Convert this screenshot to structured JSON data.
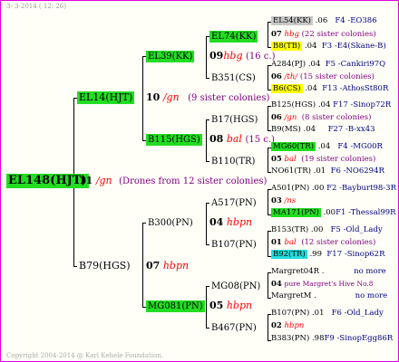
{
  "header": "3-  3-2014 ( 12: 26)",
  "copyright": "Copyright 2004-2014 @ Karl Kehele Foundation.",
  "root": {
    "code": "EL148(HJT)",
    "num": "11",
    "sub": "/gn",
    "note": "(Drones from 12 sister colonies)"
  },
  "g1": {
    "upper": {
      "code": "EL14(HJT)",
      "num": "10",
      "sub": "/gn",
      "note": "(9 sister colonies)"
    },
    "lower": {
      "code": "B79(HGS)",
      "num": "07",
      "sub": "hbpn"
    }
  },
  "g2": {
    "a": {
      "code": "EL39(KK)",
      "num": "09",
      "sub": "hbg",
      "note": "(16 c.)"
    },
    "b": {
      "code": "B115(HGS)",
      "num": "08",
      "sub": "bal",
      "note": "(15 c.)"
    },
    "c": {
      "code": "B300(PN)",
      "num": "04",
      "sub": "hbpn"
    },
    "d": {
      "code": "MG081(PN)",
      "num": "05",
      "sub": "hbpn"
    }
  },
  "g3": {
    "a1": {
      "code": "EL74(KK)"
    },
    "a2": {
      "code": "B351(CS)"
    },
    "b1": {
      "code": "B17(HGS)"
    },
    "b2": {
      "code": "B110(TR)"
    },
    "c1": {
      "code": "A517(PN)",
      "num": "03",
      "sub": "/ns"
    },
    "c2": {
      "code": "B107(PN)"
    },
    "d1": {
      "code": "MG08(PN)"
    },
    "d2": {
      "code": "B467(PN)",
      "num": "02",
      "sub": "hbpn"
    }
  },
  "g4": {
    "r1": {
      "code": "EL54(KK)",
      "val": ".06",
      "ref": "F4 -EO386"
    },
    "r2": {
      "num": "07",
      "sub": "hbg",
      "note": "(22 sister colonies)"
    },
    "r3": {
      "code": "B8(TB)",
      "val": ".04",
      "ref": "F3 -E4(Skane-B)"
    },
    "r4": {
      "code": "A284(PJ)",
      "val": ".04",
      "ref": "F5 -Cankiri97Q"
    },
    "r5": {
      "num": "06",
      "sub": "/th/",
      "note": "(15 sister colonies)"
    },
    "r6": {
      "code": "B6(CS)",
      "val": ".04",
      "ref": "F13 -AthosSt80R"
    },
    "r7": {
      "code": "B125(HGS)",
      "val": ".04",
      "ref": "F17 -Sinop72R"
    },
    "r8": {
      "num": "06",
      "sub": "/gn",
      "note": "(8 sister colonies)"
    },
    "r9": {
      "code": "B9(MS)",
      "val": ".04",
      "ref": "F27 -B-xx43"
    },
    "r10": {
      "code": "MG60(TR)",
      "val": ".04",
      "ref": "F4 -MG00R"
    },
    "r11": {
      "num": "05",
      "sub": "bal",
      "note": "(19 sister colonies)"
    },
    "r12": {
      "code": "NO61(TR)",
      "val": ".01",
      "ref": "F6 -NO6294R"
    },
    "r13": {
      "code": "A501(PN)",
      "val": ".00",
      "ref": "F2 -Bayburt98-3R"
    },
    "r14": {
      "num": "03",
      "sub": "/ns",
      "note": ""
    },
    "r15": {
      "code": "MA171(PN)",
      "val": ".00",
      "ref": "F1 -Thessal99R"
    },
    "r16": {
      "code": "B153(TR)",
      "val": ".00",
      "ref": "F5 -Old_Lady"
    },
    "r17": {
      "num": "01",
      "sub": "bal",
      "note": "(12 sister colonies)"
    },
    "r18": {
      "code": "B92(TR)",
      "val": ".99",
      "ref": "F17 -Sinop62R"
    },
    "r19": {
      "code": "Margret04R",
      "val": ".",
      "ref": "no more"
    },
    "r20": {
      "num": "04",
      "sub": "",
      "note": "pure Margret's Hive No.8"
    },
    "r21": {
      "code": "MargretM",
      "val": ".",
      "ref": "no more"
    },
    "r22": {
      "code": "B107(PN)",
      "val": ".01",
      "ref": "F6 -Old_Lady"
    },
    "r23": {
      "num": "02",
      "sub": "hbpn",
      "note": ""
    },
    "r24": {
      "code": "B383(PN)",
      "val": ".98",
      "ref": "F9 -SinopEgg86R"
    }
  }
}
